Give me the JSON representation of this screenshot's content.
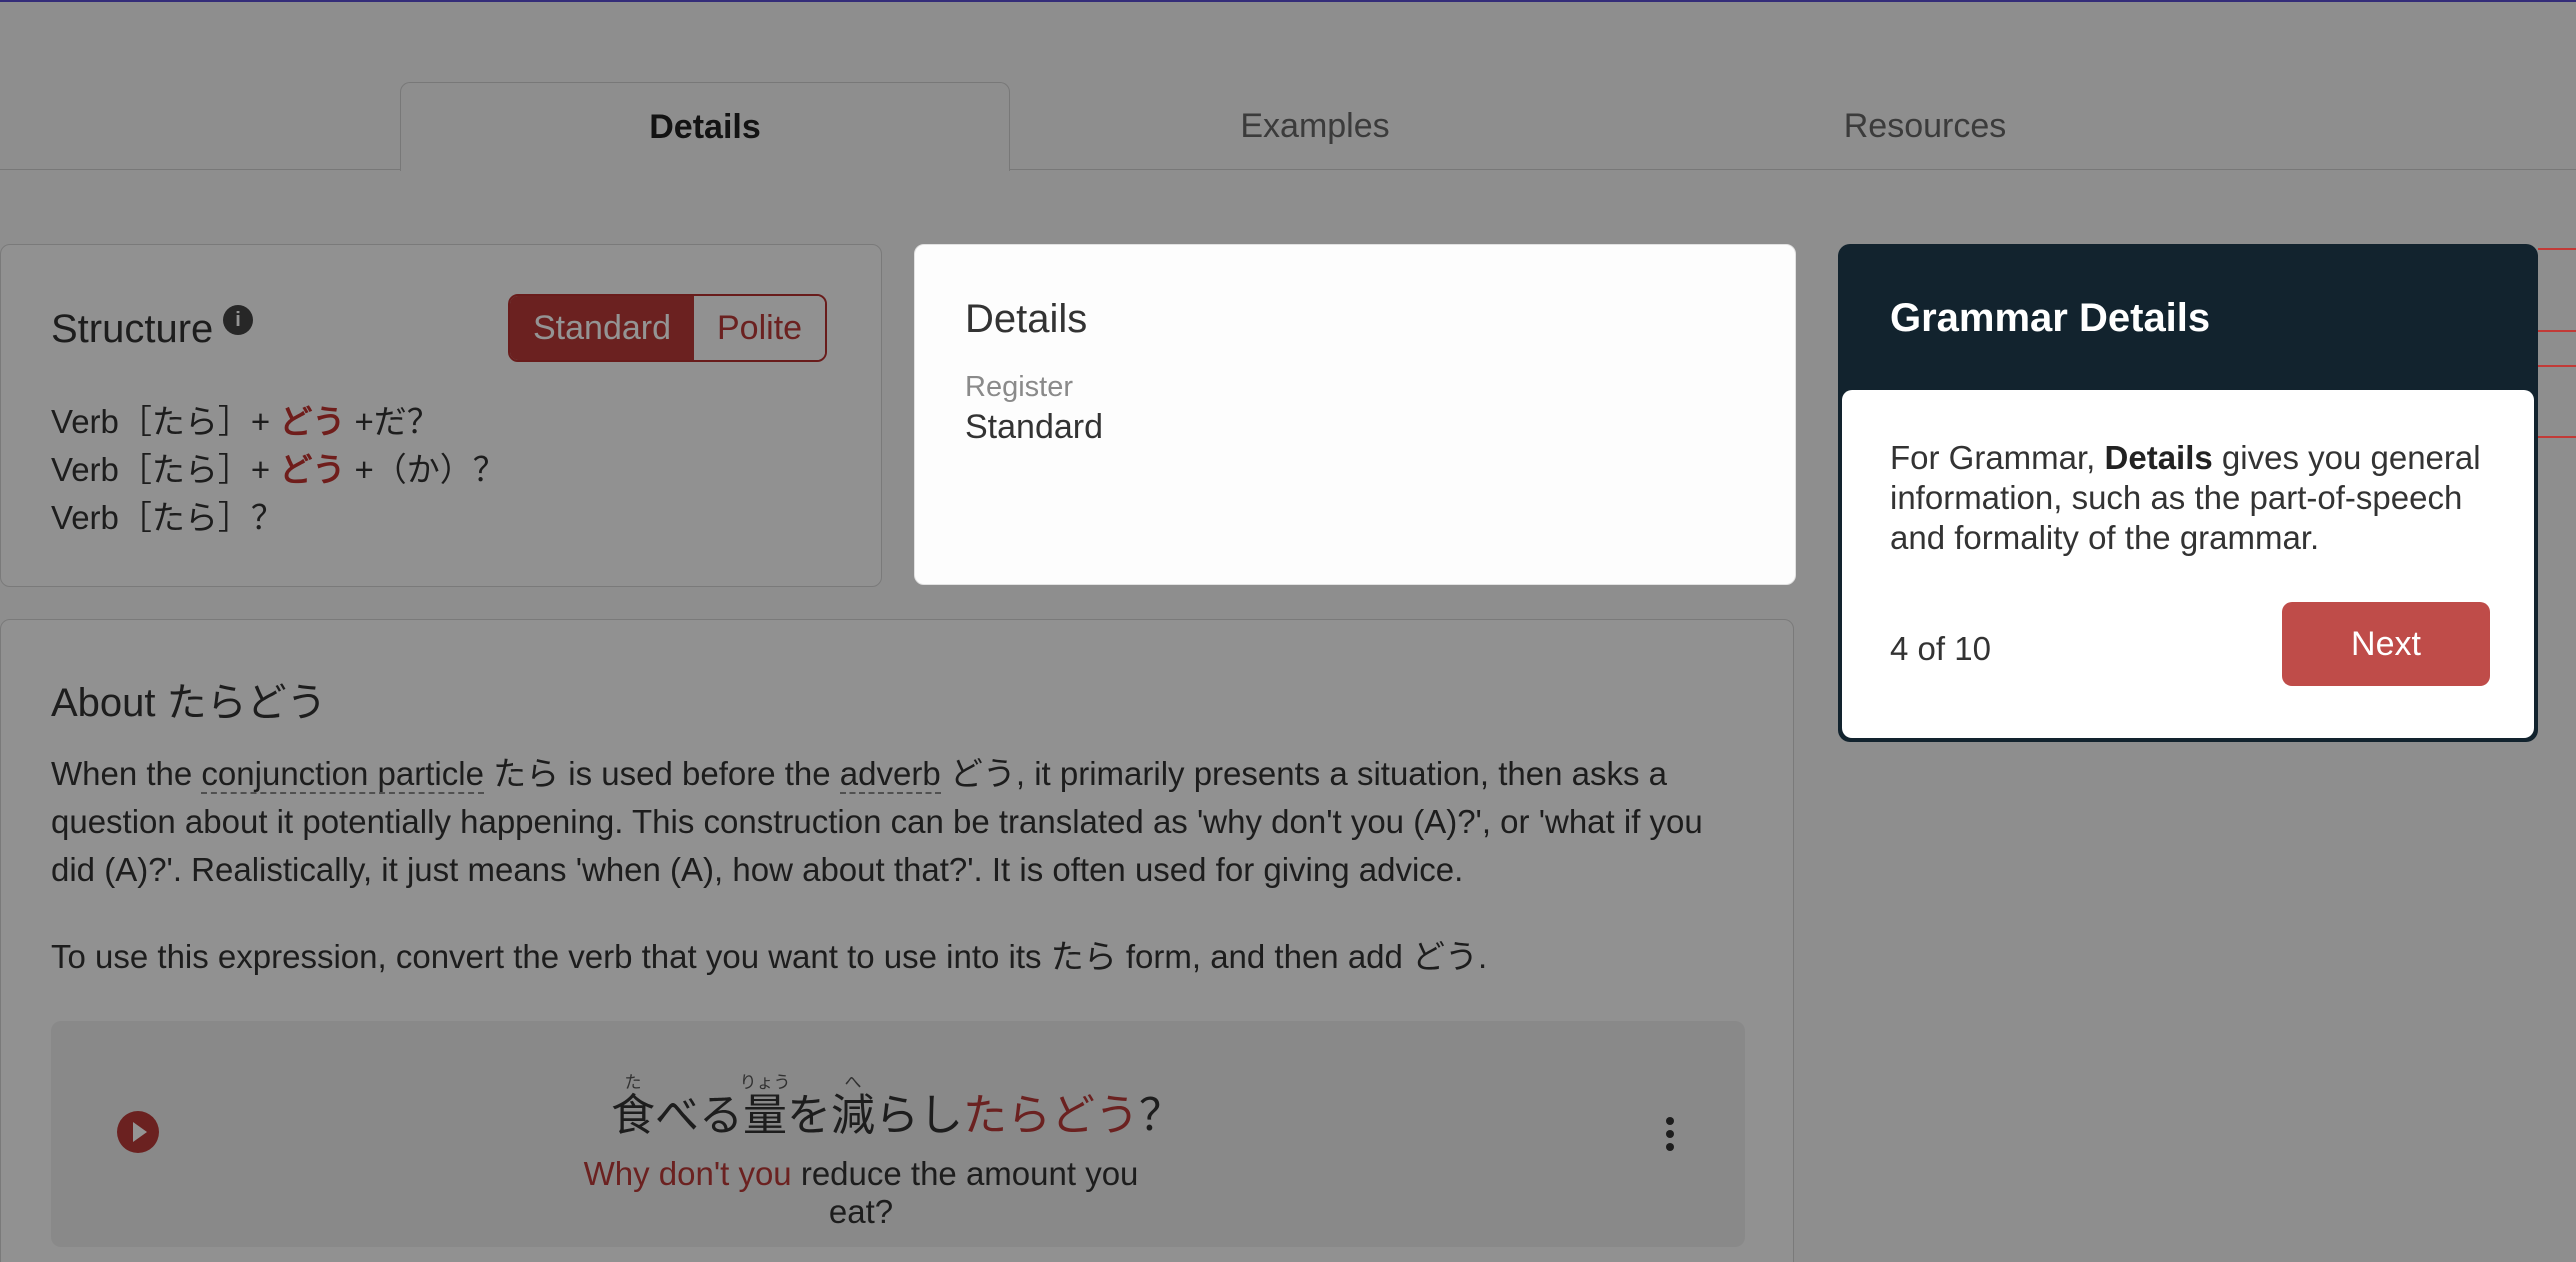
{
  "tabs": [
    {
      "label": "Details",
      "active": true
    },
    {
      "label": "Examples",
      "active": false
    },
    {
      "label": "Resources",
      "active": false
    }
  ],
  "structure": {
    "title": "Structure",
    "info_icon": "info-icon",
    "toggle": {
      "standard": "Standard",
      "polite": "Polite",
      "selected": "Standard"
    },
    "lines": [
      {
        "pre": "Verb［たら］+",
        "hl": "どう",
        "post": "+だ？"
      },
      {
        "pre": "Verb［たら］+",
        "hl": "どう",
        "post": "+（か）？"
      },
      {
        "pre": "Verb［たら］？",
        "hl": "",
        "post": ""
      }
    ]
  },
  "details": {
    "title": "Details",
    "register_label": "Register",
    "register_value": "Standard"
  },
  "about": {
    "heading": "About たらどう",
    "p1": {
      "a": "When the ",
      "link1": "conjunction particle",
      "b": " たら is used before the ",
      "link2": "adverb",
      "c": " どう, it primarily presents a situation, then asks a question about it potentially happening. This construction can be translated as 'why don't you (A)?', or 'what if you did (A)?'. Realistically, it just means 'when (A), how about that?'. It is often used for giving advice."
    },
    "p2": "To use this expression, convert the verb that you want to use into its たら form, and then add どう.",
    "example": {
      "jp_base_1": "食",
      "jp_ruby_1": "た",
      "jp_text_1": "べる",
      "jp_base_2": "量",
      "jp_ruby_2": "りょう",
      "jp_text_2": "を",
      "jp_base_3": "減",
      "jp_ruby_3": "へ",
      "jp_text_3": "らし",
      "jp_hl": "たらどう",
      "jp_end": "？",
      "en_hl": "Why don't you",
      "en_rest": " reduce the amount you eat?",
      "play_icon": "play-icon",
      "more_icon": "more-vertical-icon"
    }
  },
  "popover": {
    "title": "Grammar Details",
    "text_pre": "For Grammar, ",
    "text_bold": "Details",
    "text_post": " gives you general information, such as the part-of-speech and formality of the grammar.",
    "counter": "4 of 10",
    "next_label": "Next"
  },
  "colors": {
    "accent": "#b83a37",
    "popover_header": "#12232e",
    "overlay": "rgba(0,0,0,0.42)"
  }
}
